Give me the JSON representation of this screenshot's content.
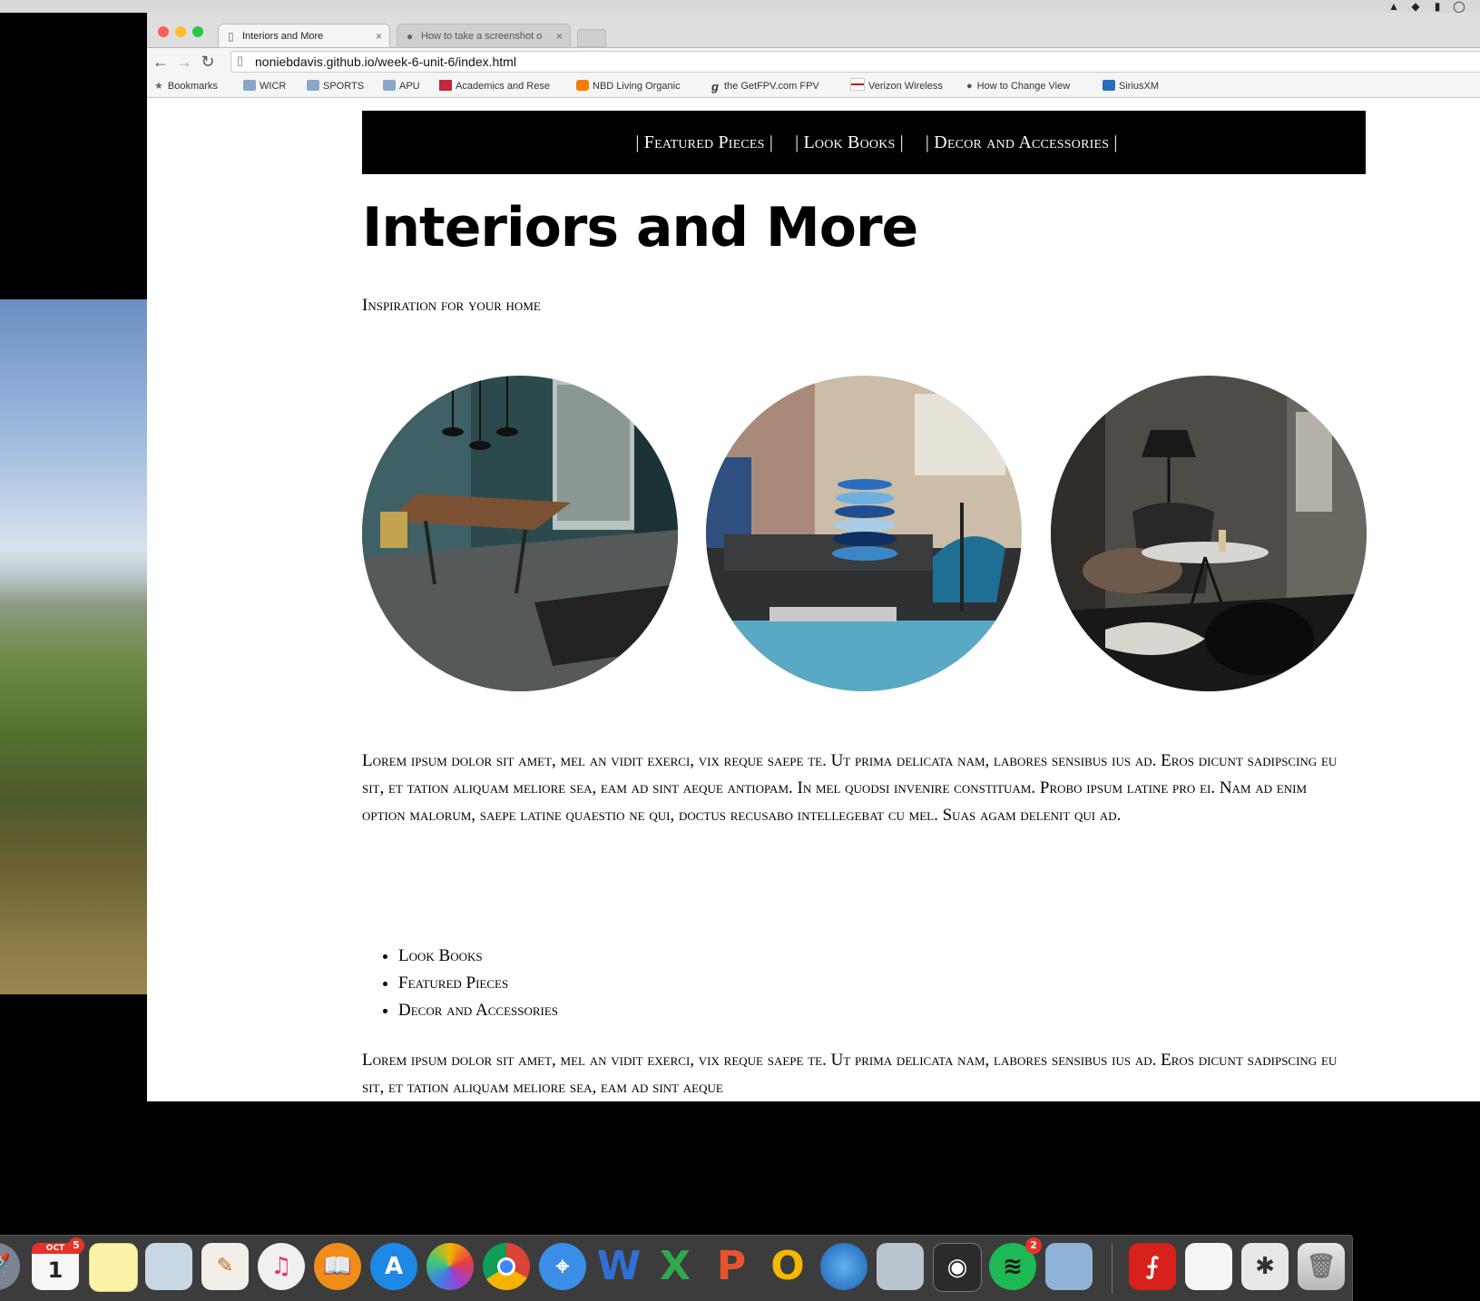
{
  "browser": {
    "tabs": [
      {
        "label": "Interiors and More"
      },
      {
        "label": "How to take a screenshot o"
      }
    ],
    "url": "noniebdavis.github.io/week-6-unit-6/index.html",
    "bookmarks": [
      {
        "label": "Bookmarks"
      },
      {
        "label": "WICR"
      },
      {
        "label": "SPORTS"
      },
      {
        "label": "APU"
      },
      {
        "label": "Academics and Rese"
      },
      {
        "label": "NBD Living Organic"
      },
      {
        "label": "the GetFPV.com FPV"
      },
      {
        "label": "Verizon Wireless"
      },
      {
        "label": "How to Change View"
      },
      {
        "label": "SiriusXM"
      }
    ]
  },
  "site": {
    "nav": [
      {
        "label": "| Featured Pieces |"
      },
      {
        "label": "| Look Books |"
      },
      {
        "label": "| Decor and Accessories |"
      }
    ],
    "title": "Interiors and More",
    "tagline": "Inspiration for your home",
    "paragraph1": "Lorem ipsum dolor sit amet, mel an vidit exerci, vix reque saepe te. Ut prima delicata nam, labores sensibus ius ad. Eros dicunt sadipscing eu sit, et tation aliquam meliore sea, eam ad sint aeque antiopam. In mel quodsi invenire constituam. Probo ipsum latine pro ei. Nam ad enim option malorum, saepe latine quaestio ne qui, doctus recusabo intellegebat cu mel. Suas agam delenit qui ad.",
    "list": [
      {
        "label": "Look Books"
      },
      {
        "label": "Featured Pieces"
      },
      {
        "label": "Decor and Accessories"
      }
    ],
    "paragraph2": "Lorem ipsum dolor sit amet, mel an vidit exerci, vix reque saepe te. Ut prima delicata nam, labores sensibus ius ad. Eros dicunt sadipscing eu sit, et tation aliquam meliore sea, eam ad sint aeque"
  },
  "dock": {
    "calendar": {
      "month": "OCT",
      "day": "1",
      "badge": "5"
    },
    "spotify_badge": "2",
    "letters": {
      "word": "W",
      "excel": "X",
      "powerpoint": "P",
      "outlook": "O"
    }
  }
}
